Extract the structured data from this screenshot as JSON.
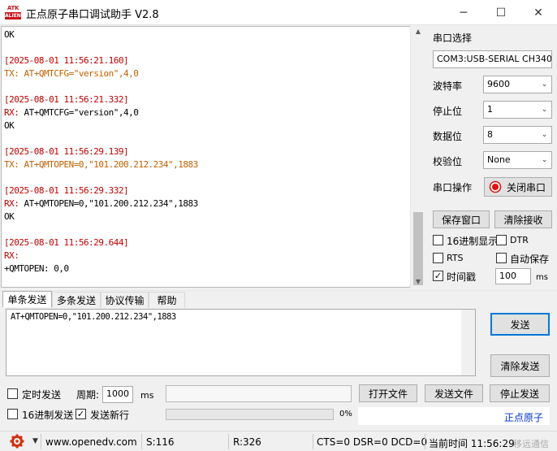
{
  "window": {
    "logo_top": "ATK",
    "logo_bottom": "ALIENTEK",
    "title": "正点原子串口调试助手 V2.8",
    "min_glyph": "─",
    "max_glyph": "☐",
    "close_glyph": "✕"
  },
  "log": [
    {
      "text": "OK",
      "color": "#000000"
    },
    {
      "text": "",
      "color": "#000000"
    },
    {
      "text": "[2025-08-01 11:56:21.160]",
      "color": "#c00000"
    },
    {
      "text": "TX: AT+QMTCFG=\"version\",4,0",
      "color": "#c06000",
      "prefix": "TX:"
    },
    {
      "text": "",
      "color": "#000000"
    },
    {
      "text": "[2025-08-01 11:56:21.332]",
      "color": "#c00000"
    },
    {
      "text": "RX: AT+QMTCFG=\"version\",4,0",
      "color": "#000000",
      "prefix": "RX:"
    },
    {
      "text": "OK",
      "color": "#000000"
    },
    {
      "text": "",
      "color": "#000000"
    },
    {
      "text": "[2025-08-01 11:56:29.139]",
      "color": "#c00000"
    },
    {
      "text": "TX: AT+QMTOPEN=0,\"101.200.212.234\",1883",
      "color": "#c06000",
      "prefix": "TX:"
    },
    {
      "text": "",
      "color": "#000000"
    },
    {
      "text": "[2025-08-01 11:56:29.332]",
      "color": "#c00000"
    },
    {
      "text": "RX: AT+QMTOPEN=0,\"101.200.212.234\",1883",
      "color": "#000000",
      "prefix": "RX:"
    },
    {
      "text": "OK",
      "color": "#000000"
    },
    {
      "text": "",
      "color": "#000000"
    },
    {
      "text": "[2025-08-01 11:56:29.644]",
      "color": "#c00000"
    },
    {
      "text": "RX:",
      "color": "#c00000",
      "prefix": "RX:"
    },
    {
      "text": "+QMTOPEN: 0,0",
      "color": "#000000"
    }
  ],
  "panel": {
    "port_select_label": "串口选择",
    "port_value": "COM3:USB-SERIAL CH340",
    "baud_label": "波特率",
    "baud_value": "9600",
    "stop_label": "停止位",
    "stop_value": "1",
    "data_label": "数据位",
    "data_value": "8",
    "parity_label": "校验位",
    "parity_value": "None",
    "port_op_label": "串口操作",
    "close_port_label": "关闭串口",
    "save_window_label": "保存窗口",
    "clear_receive_label": "清除接收",
    "hex_display_label": "16进制显示",
    "dtr_label": "DTR",
    "rts_label": "RTS",
    "auto_save_label": "自动保存",
    "timestamp_label": "时间戳",
    "timestamp_value": "100",
    "timestamp_unit": "ms",
    "status_color": "#e01010"
  },
  "tabs": [
    "单条发送",
    "多条发送",
    "协议传输",
    "帮助"
  ],
  "send": {
    "text": "AT+QMTOPEN=0,\"101.200.212.234\",1883",
    "send_label": "发送",
    "clear_send_label": "清除发送",
    "timed_send_label": "定时发送",
    "period_label": "周期:",
    "period_value": "1000",
    "period_unit": "ms",
    "open_file_label": "打开文件",
    "send_file_label": "发送文件",
    "stop_send_label": "停止发送",
    "hex_send_label": "16进制发送",
    "newline_label": "发送新行",
    "progress_text": "0%",
    "progress": 0,
    "brand_link": "正点原子"
  },
  "status": {
    "url": "www.openedv.com",
    "sent": "S:116",
    "received": "R:326",
    "lines": "CTS=0 DSR=0 DCD=0",
    "time": "当前时间 11:56:29",
    "watermark": "移远通信"
  }
}
